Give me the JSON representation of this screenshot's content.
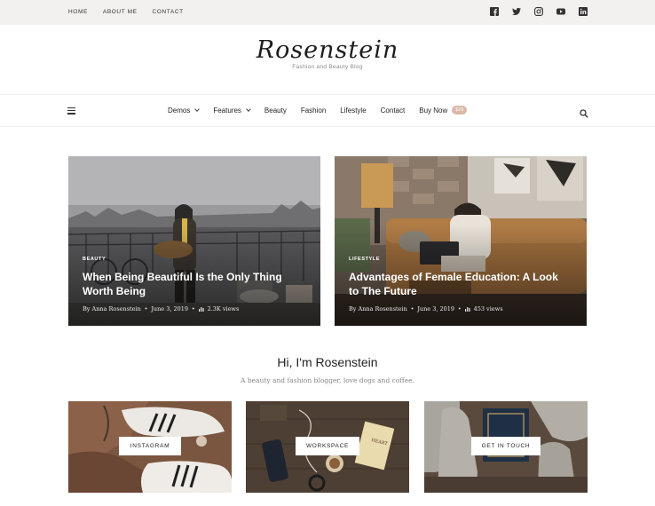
{
  "topbar": {
    "nav": [
      "HOME",
      "ABOUT ME",
      "CONTACT"
    ],
    "social": [
      "facebook-icon",
      "twitter-icon",
      "instagram-icon",
      "youtube-icon",
      "linkedin-icon"
    ]
  },
  "logo": {
    "title": "Rosenstein",
    "tagline": "Fashion and Beauty Blog"
  },
  "menu": {
    "items": [
      "Demos",
      "Features",
      "Beauty",
      "Fashion",
      "Lifestyle",
      "Contact",
      "Buy Now"
    ],
    "badge": "$29"
  },
  "featured": [
    {
      "category": "BEAUTY",
      "title": "When Being Beautiful Is the Only Thing Worth Being",
      "author": "By Anna Rosenstein",
      "date": "June 3, 2019",
      "views": "2.3K views"
    },
    {
      "category": "LIFESTYLE",
      "title": "Advantages of Female Education: A Look to The Future",
      "author": "By Anna Rosenstein",
      "date": "June 3, 2019",
      "views": "453 views"
    }
  ],
  "intro": {
    "title": "Hi, I'm Rosenstein",
    "subtitle": "A beauty and fashion blogger, love dogs and coffee."
  },
  "tiles": [
    "INSTAGRAM",
    "WORKSPACE",
    "GET IN TOUCH"
  ],
  "colors": {
    "topbar_bg": "#f3f1ef",
    "badge": "#d9b8a6",
    "text": "#222222"
  }
}
